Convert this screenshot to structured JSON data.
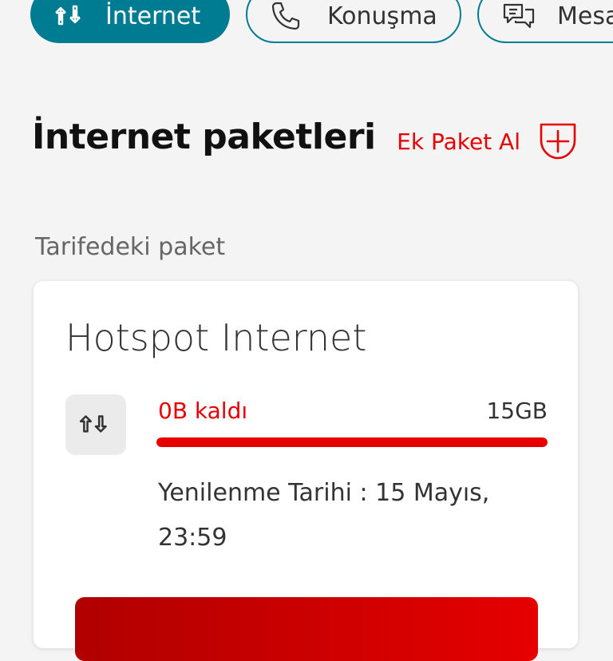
{
  "tabs": [
    {
      "label": "İnternet",
      "icon": "arrows-updown-icon",
      "active": true
    },
    {
      "label": "Konuşma",
      "icon": "phone-icon",
      "active": false
    },
    {
      "label": "Mesaj",
      "icon": "chat-icon",
      "active": false
    }
  ],
  "section": {
    "title": "İnternet paketleri",
    "add_label": "Ek Paket Al"
  },
  "subtitle": "Tarifedeki paket",
  "package": {
    "name": "Hotspot Internet",
    "remaining": "0B kaldı",
    "total": "15GB",
    "usage_fraction": 1.0,
    "renewal": "Yenilenme Tarihi : 15 Mayıs, 23:59"
  },
  "colors": {
    "accent": "#007c92",
    "red": "#e60000"
  }
}
